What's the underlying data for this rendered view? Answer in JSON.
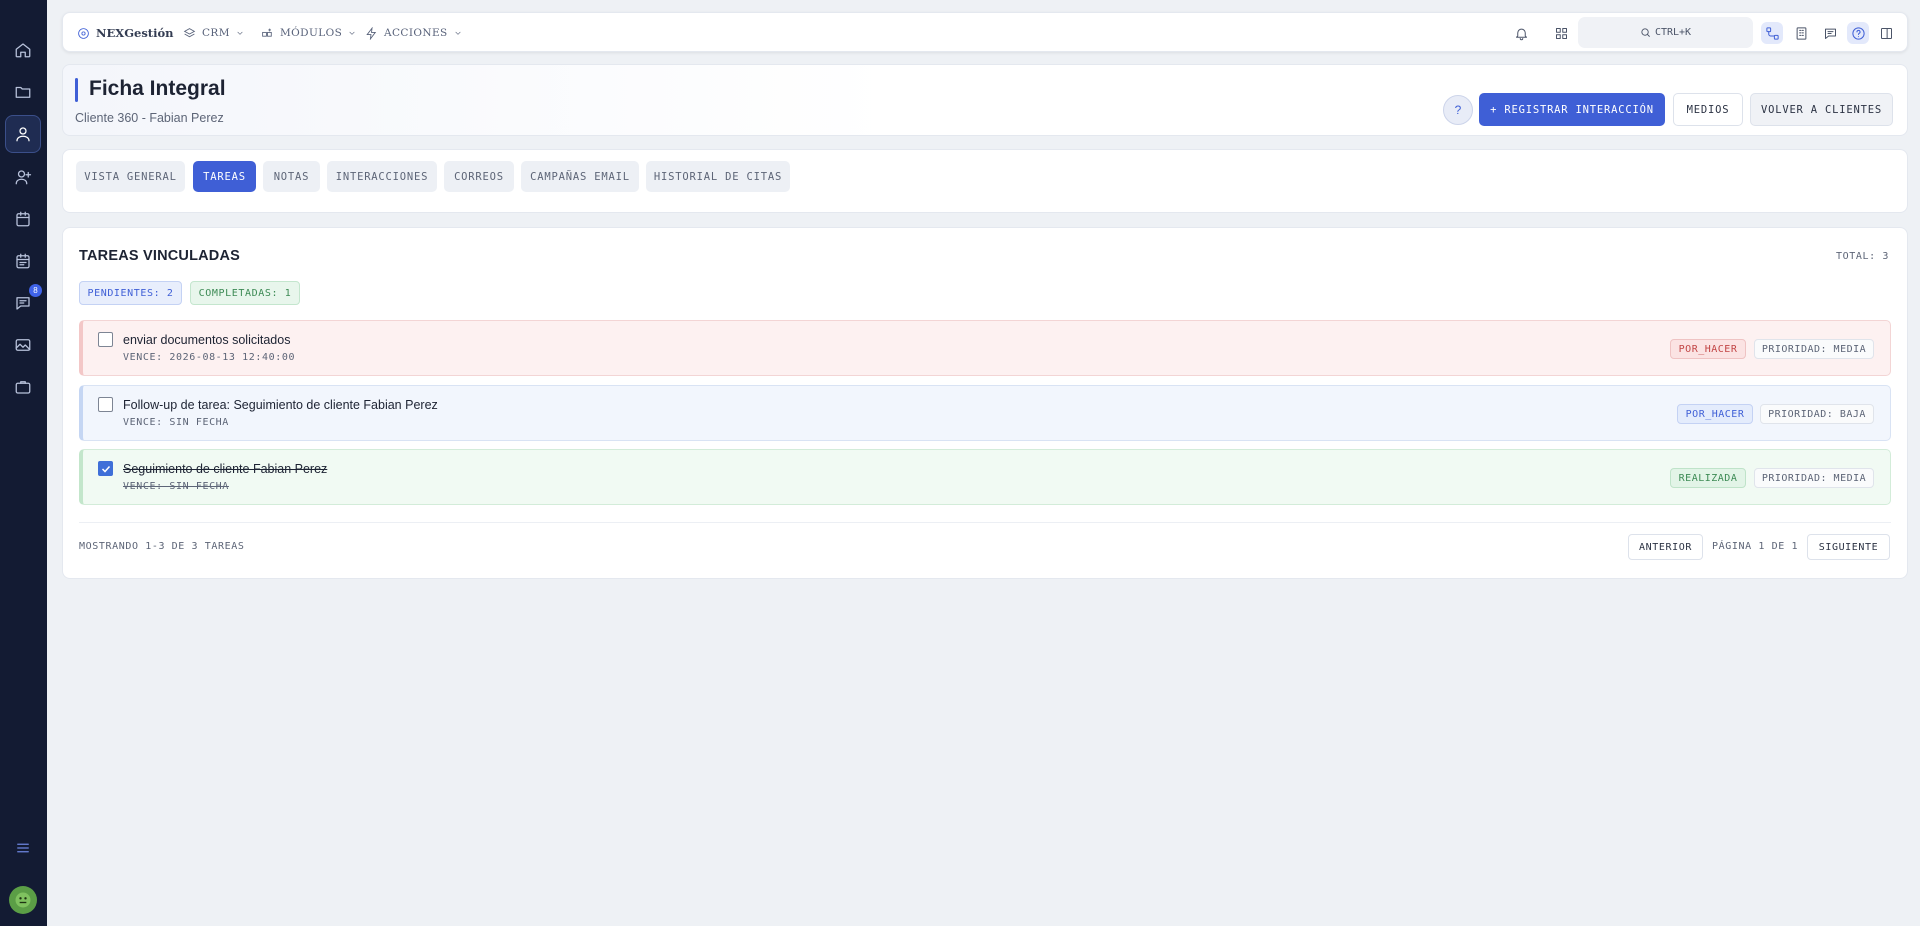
{
  "topbar": {
    "brand": "NEXGestión",
    "menu": [
      {
        "label": "CRM"
      },
      {
        "label": "MÓDULOS"
      },
      {
        "label": "ACCIONES"
      }
    ],
    "search_label": "CTRL+K"
  },
  "sidebar": {
    "chat_badge": "8",
    "items": [
      "home",
      "folder",
      "user",
      "add-user",
      "calendar",
      "calendar-alt",
      "chat",
      "image",
      "briefcase"
    ]
  },
  "header": {
    "title": "Ficha Integral",
    "subtitle": "Cliente 360 - Fabian Perez",
    "help_label": "?",
    "register_label": "+ REGISTRAR INTERACCIÓN",
    "media_label": "MEDIOS",
    "back_label": "VOLVER A CLIENTES"
  },
  "tabs": [
    {
      "label": "VISTA GENERAL",
      "active": false
    },
    {
      "label": "TAREAS",
      "active": true
    },
    {
      "label": "NOTAS",
      "active": false
    },
    {
      "label": "INTERACCIONES",
      "active": false
    },
    {
      "label": "CORREOS",
      "active": false
    },
    {
      "label": "CAMPAÑAS EMAIL",
      "active": false
    },
    {
      "label": "HISTORIAL DE CITAS",
      "active": false
    }
  ],
  "tasks_section": {
    "title": "TAREAS VINCULADAS",
    "total": "TOTAL: 3",
    "pending_chip": "PENDIENTES: 2",
    "completed_chip": "COMPLETADAS: 1",
    "tasks": [
      {
        "title": "enviar documentos solicitados",
        "due": "VENCE: 2026-08-13 12:40:00",
        "status": "POR_HACER",
        "priority": "PRIORIDAD: MEDIA",
        "checked": false
      },
      {
        "title": "Follow-up de tarea: Seguimiento de cliente Fabian Perez",
        "due": "VENCE: SIN FECHA",
        "status": "POR_HACER",
        "priority": "PRIORIDAD: BAJA",
        "checked": false
      },
      {
        "title": "Seguimiento de cliente Fabian Perez",
        "due": "VENCE: SIN FECHA",
        "status": "REALIZADA",
        "priority": "PRIORIDAD: MEDIA",
        "checked": true
      }
    ],
    "showing": "MOSTRANDO 1-3 DE 3 TAREAS",
    "prev_label": "ANTERIOR",
    "page_info": "PÁGINA 1 DE 1",
    "next_label": "SIGUIENTE"
  },
  "colors": {
    "accent": "#3f5fd6",
    "sidebar_bg": "#131b33",
    "page_bg": "#eef1f5"
  }
}
